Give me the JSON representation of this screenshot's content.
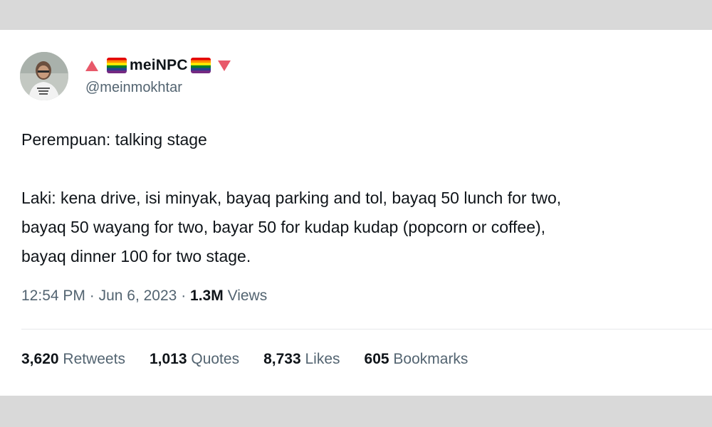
{
  "author": {
    "display_name": "meiNPC",
    "handle": "@meinmokhtar",
    "decorations": [
      "red-up-triangle-icon",
      "rainbow-flag-icon",
      "rainbow-flag-icon",
      "red-down-triangle-icon"
    ]
  },
  "tweet": {
    "line1": "Perempuan: talking stage",
    "line2": "Laki: kena drive, isi minyak, bayaq parking and tol, bayaq 50 lunch for two,",
    "line3": "bayaq 50 wayang for two, bayar 50 for kudap kudap (popcorn or coffee),",
    "line4": "bayaq dinner 100 for two stage."
  },
  "meta": {
    "time": "12:54 PM",
    "separator": "·",
    "date": "Jun 6, 2023",
    "views_count": "1.3M",
    "views_label": "Views"
  },
  "stats": {
    "retweets": {
      "count": "3,620",
      "label": "Retweets"
    },
    "quotes": {
      "count": "1,013",
      "label": "Quotes"
    },
    "likes": {
      "count": "8,733",
      "label": "Likes"
    },
    "bookmarks": {
      "count": "605",
      "label": "Bookmarks"
    }
  },
  "colors": {
    "background_frame": "#d9d9d9",
    "card": "#ffffff",
    "text_primary": "#0f1419",
    "text_secondary": "#536471",
    "accent_triangle": "#e8596a"
  }
}
